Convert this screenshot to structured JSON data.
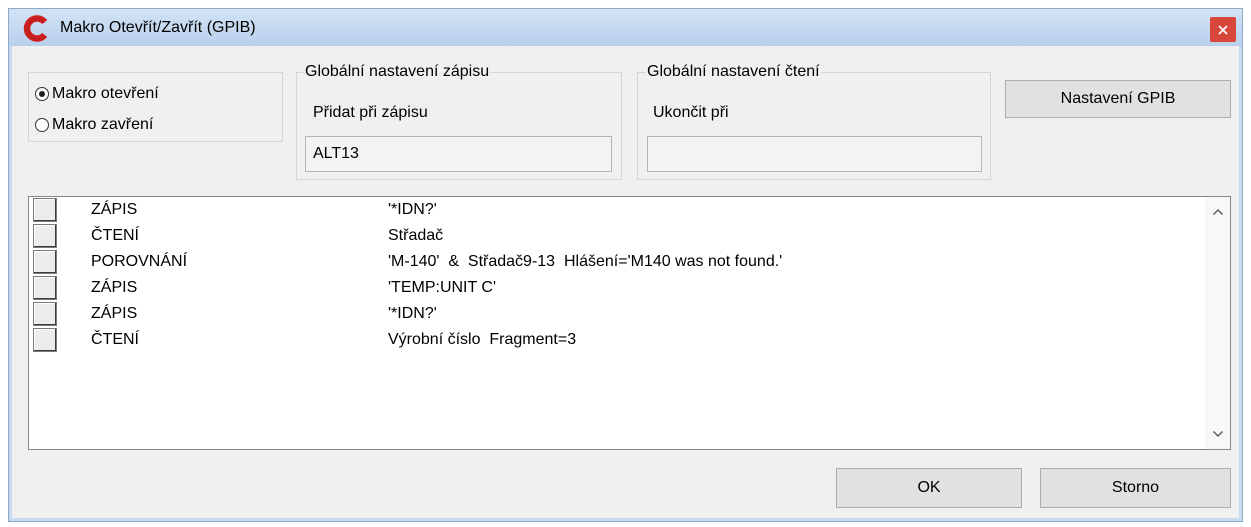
{
  "window": {
    "title": "Makro Otevřít/Zavřít (GPIB)",
    "logo_icon": "app-logo-icon",
    "close_icon": "close-icon"
  },
  "macro_type": {
    "options": [
      {
        "label": "Makro otevření",
        "checked": true
      },
      {
        "label": "Makro zavření",
        "checked": false
      }
    ]
  },
  "write_settings": {
    "title": "Globální nastavení zápisu",
    "label": "Přidat při zápisu",
    "value": "ALT13"
  },
  "read_settings": {
    "title": "Globální nastavení čtení",
    "label": "Ukončit při",
    "value": ""
  },
  "gpib_settings_button": "Nastavení GPIB",
  "steps": [
    {
      "action": "ZÁPIS",
      "value": "'*IDN?'"
    },
    {
      "action": "ČTENÍ",
      "value": "Střadač"
    },
    {
      "action": "POROVNÁNÍ",
      "value": "'M-140'  &  Střadač9-13  Hlášení='M140 was not found.'"
    },
    {
      "action": "ZÁPIS",
      "value": "'TEMP:UNIT C'"
    },
    {
      "action": "ZÁPIS",
      "value": "'*IDN?'"
    },
    {
      "action": "ČTENÍ",
      "value": "Výrobní číslo  Fragment=3"
    }
  ],
  "scrollbar": {
    "up_icon": "chevron-up-icon",
    "down_icon": "chevron-down-icon"
  },
  "footer": {
    "ok_label": "OK",
    "cancel_label": "Storno"
  },
  "colors": {
    "title_bar": "#c5d9f0",
    "close_button": "#d9463b",
    "logo": "#cc1f1f",
    "dialog_background": "#f0f0f0",
    "list_background": "#ffffff"
  }
}
